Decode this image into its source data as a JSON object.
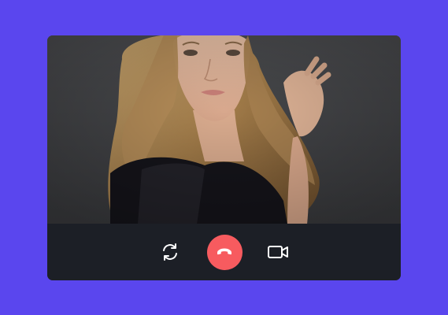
{
  "call": {
    "remote_video": "video-feed-woman-portrait",
    "controls": {
      "switch_camera_icon": "camera-switch-icon",
      "end_call_icon": "phone-hangup-icon",
      "video_icon": "video-camera-icon"
    },
    "colors": {
      "background": "#5a46ee",
      "controls_bar": "#1c1f26",
      "end_call": "#f75b5f",
      "icon": "#ffffff"
    }
  }
}
